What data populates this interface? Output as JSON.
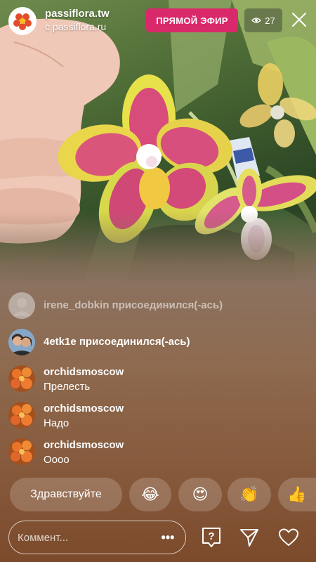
{
  "header": {
    "account_name": "passiflora.tw",
    "account_sub": "с passiflora.ru",
    "live_label": "ПРЯМОЙ ЭФИР",
    "viewer_count": "27",
    "viewer_icon": "eye-icon",
    "close_icon": "close-icon"
  },
  "chat": [
    {
      "user": "irene_dobkin",
      "text": "irene_dobkin присоединился(-ась)",
      "type": "join",
      "avatar": "default-avatar"
    },
    {
      "user": "4etk1e",
      "text": "4etk1e присоединился(-ась)",
      "type": "join",
      "avatar": "couple-photo-avatar"
    },
    {
      "user": "orchidsmoscow",
      "text": "Прелесть",
      "type": "comment",
      "avatar": "orchid-avatar"
    },
    {
      "user": "orchidsmoscow",
      "text": "Надо",
      "type": "comment",
      "avatar": "orchid-avatar"
    },
    {
      "user": "orchidsmoscow",
      "text": "Оооо",
      "type": "comment",
      "avatar": "orchid-avatar"
    }
  ],
  "quick_replies": {
    "text_reply": "Здравствуйте",
    "emojis": [
      "😂",
      "😍",
      "👏",
      "👍"
    ]
  },
  "bottom_bar": {
    "comment_placeholder": "Коммент...",
    "more_label": "•••",
    "icons": [
      "question-box-icon",
      "send-icon",
      "heart-icon"
    ]
  },
  "colors": {
    "live_badge": "#d9296b",
    "chat_bg_top": "#8b7260",
    "chat_bg_bottom": "#7b4a2b"
  }
}
